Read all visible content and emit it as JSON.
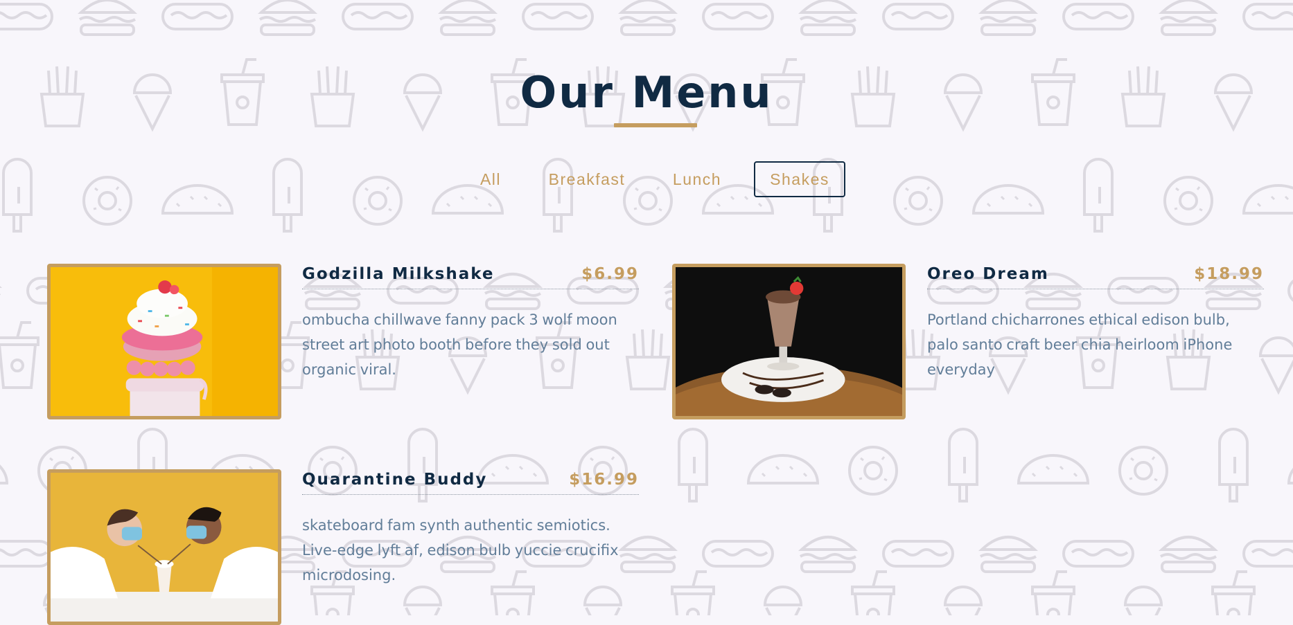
{
  "page": {
    "title": "Our Menu"
  },
  "filters": [
    {
      "label": "All",
      "active": false
    },
    {
      "label": "Breakfast",
      "active": false
    },
    {
      "label": "Lunch",
      "active": false
    },
    {
      "label": "Shakes",
      "active": true
    }
  ],
  "menu_items": [
    {
      "name": "Godzilla Milkshake",
      "price": "$6.99",
      "description": "ombucha chillwave fanny pack 3 wolf moon street art photo booth before they sold out organic viral.",
      "image": "godzilla-milkshake-photo"
    },
    {
      "name": "Oreo Dream",
      "price": "$18.99",
      "description": "Portland chicharrones ethical edison bulb, palo santo craft beer chia heirloom iPhone everyday",
      "image": "oreo-dream-photo"
    },
    {
      "name": "Quarantine Buddy",
      "price": "$16.99",
      "description": "skateboard fam synth authentic semiotics. Live-edge lyft af, edison bulb yuccie crucifix microdosing.",
      "image": "quarantine-buddy-photo"
    }
  ],
  "colors": {
    "background": "#f8f6fb",
    "primary": "#102a43",
    "accent": "#c59d5f",
    "text_muted": "#617d98",
    "pattern": "#dcd9e0"
  },
  "background_icons": [
    "hotdog-icon",
    "burger-icon",
    "soda-cup-icon",
    "ice-cream-cone-icon",
    "fries-icon",
    "popsicle-icon",
    "taco-icon",
    "donut-icon"
  ]
}
